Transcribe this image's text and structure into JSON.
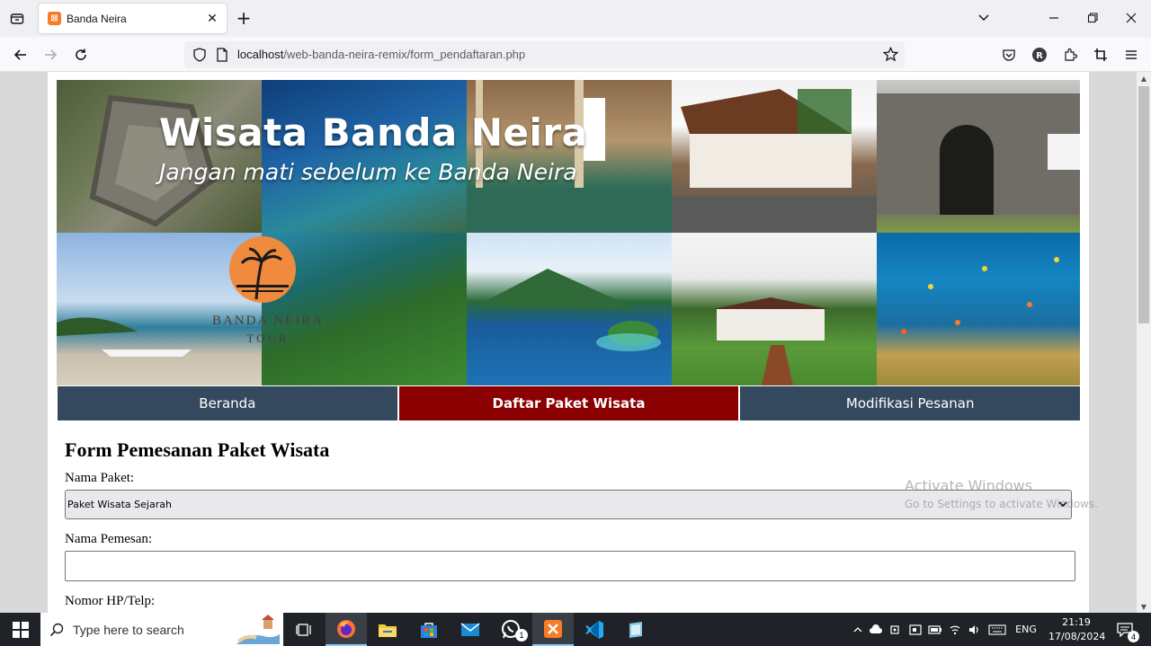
{
  "browser": {
    "tab_title": "Banda Neira",
    "url_host": "localhost",
    "url_path": "/web-banda-neira-remix/form_pendaftaran.php"
  },
  "banner": {
    "title": "Wisata Banda Neira",
    "subtitle": "Jangan mati sebelum ke Banda Neira",
    "logo_text": "BANDA NEIRA",
    "logo_text2": "TOUR",
    "photos": [
      "aerial-fort",
      "coast-sea",
      "museum-building",
      "colonial-house",
      "old-fort-gate",
      "beach-boat",
      "green-island",
      "volcano-island",
      "governor-house",
      "coral-reef"
    ]
  },
  "menu": {
    "items": [
      {
        "label": "Beranda",
        "active": false
      },
      {
        "label": "Daftar Paket Wisata",
        "active": true
      },
      {
        "label": "Modifikasi Pesanan",
        "active": false
      }
    ]
  },
  "form": {
    "title": "Form Pemesanan Paket Wisata",
    "paket_label": "Nama Paket:",
    "paket_value": "Paket Wisata Sejarah",
    "pemesan_label": "Nama Pemesan:",
    "pemesan_value": "",
    "hp_label": "Nomor HP/Telp:"
  },
  "watermark": {
    "line1": "Activate Windows",
    "line2": "Go to Settings to activate Windows."
  },
  "taskbar": {
    "search_placeholder": "Type here to search",
    "whatsapp_badge": "1",
    "language": "ENG",
    "time": "21:19",
    "date": "17/08/2024",
    "notification_count": "4"
  },
  "colors": {
    "menu_bg": "#34495e",
    "menu_active": "#8b0000"
  }
}
